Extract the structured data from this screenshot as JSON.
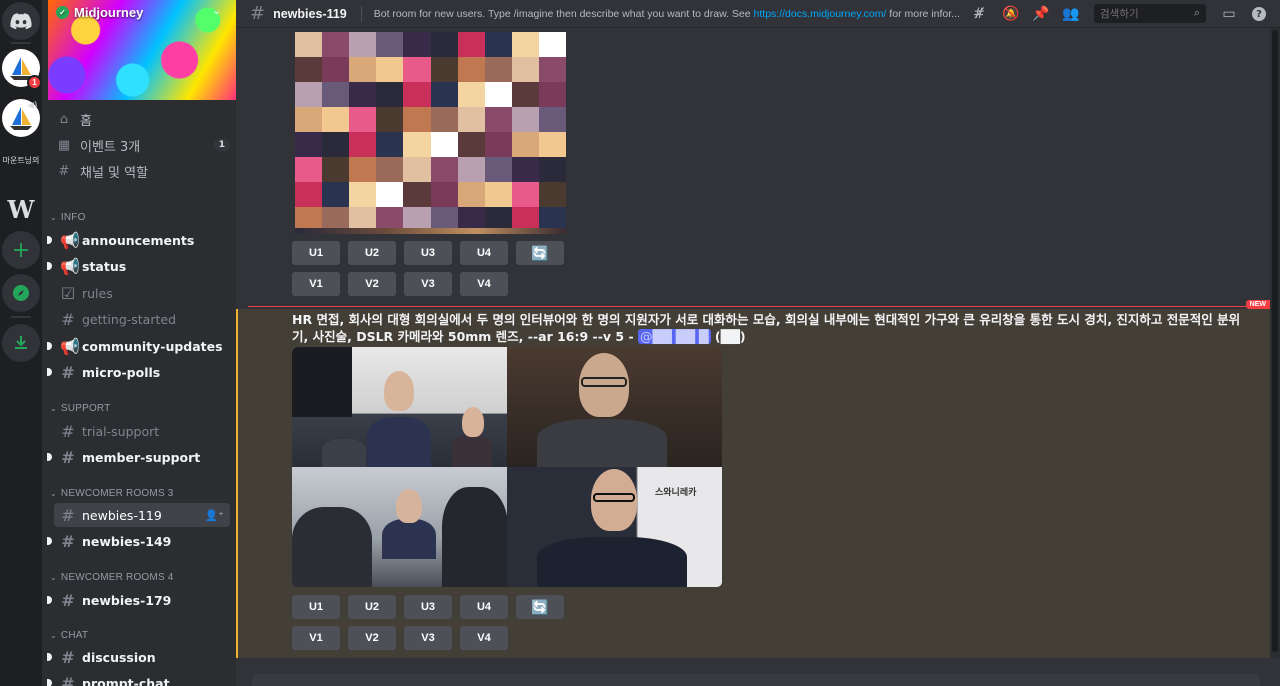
{
  "server": {
    "name": "Midjourney",
    "unread_count": "1",
    "side_label": "마운트닝의"
  },
  "nav": {
    "home": "홈",
    "events": "이벤트 3개",
    "events_count": "1",
    "channels_roles": "채널 및 역할"
  },
  "categories": {
    "info": "INFO",
    "support": "SUPPORT",
    "newcomer3": "NEWCOMER ROOMS 3",
    "newcomer4": "NEWCOMER ROOMS 4",
    "chat": "CHAT"
  },
  "channels": {
    "announcements": "announcements",
    "status": "status",
    "rules": "rules",
    "getting_started": "getting-started",
    "community_updates": "community-updates",
    "micro_polls": "micro-polls",
    "trial_support": "trial-support",
    "member_support": "member-support",
    "newbies_119": "newbies-119",
    "newbies_149": "newbies-149",
    "newbies_179": "newbies-179",
    "discussion": "discussion",
    "prompt_chat": "prompt-chat"
  },
  "topbar": {
    "channel_name": "newbies-119",
    "topic_prefix": "Bot room for new users. Type /imagine then describe what you want to draw. See ",
    "topic_link": "https://docs.midjourney.com/",
    "topic_suffix": " for more infor...",
    "search_placeholder": "검색하기"
  },
  "messages": {
    "buttons_upscale": [
      "U1",
      "U2",
      "U3",
      "U4"
    ],
    "buttons_variation": [
      "V1",
      "V2",
      "V3",
      "V4"
    ],
    "new_label": "NEW",
    "prompt_text": "HR 면접, 회사의 대형 회의실에서 두 명의 인터뷰어와 한 명의 지원자가 서로 대화하는 모습, 회의실 내부에는 현대적인 가구와 큰 유리창을 통한 도시 경치, 진지하고 전문적인 분위기, 사진술, DSLR 카메라와 50mm 렌즈, --ar 16:9 --v 5 - ",
    "prompt_mention": "@██ ██ █",
    "prompt_tail": " (██)",
    "panel_sign_text": "스와니레카"
  },
  "colors": {
    "accent_unread": "#f23f43",
    "highlight_border": "#f0b232",
    "link": "#00a8fc",
    "verified": "#23a55a"
  },
  "icons": [
    "discord-logo-icon",
    "sailboat-server-icon",
    "webflow-server-icon",
    "add-server-icon",
    "explore-icon",
    "download-icon",
    "threads-icon",
    "mute-icon",
    "pin-icon",
    "members-icon",
    "search-icon",
    "inbox-icon",
    "help-icon",
    "refresh-icon"
  ]
}
